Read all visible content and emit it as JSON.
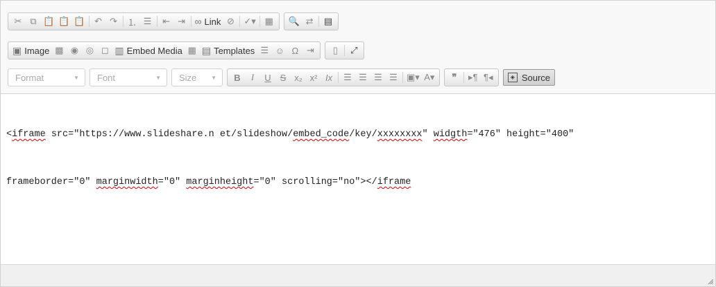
{
  "toolbar": {
    "row1": {
      "link_label": "Link"
    },
    "row2": {
      "image_label": "Image",
      "embed_media_label": "Embed Media",
      "templates_label": "Templates"
    },
    "row3": {
      "format_combo": "Format",
      "font_combo": "Font",
      "size_combo": "Size",
      "source_label": "Source"
    }
  },
  "content": {
    "line1": {
      "p0": "<",
      "w_iframe": "iframe",
      "p1": " src=\"https://www.slideshare.n et/slideshow/",
      "w_embed": "embed_code",
      "p2": "/key/",
      "w_xxx": "xxxxxxxx",
      "p3": "\" ",
      "w_widgth": "widgth",
      "p4": "=\"476\" height=\"400\""
    },
    "line2": {
      "p0": "frameborder=\"0\" ",
      "w_marginwidth": "marginwidth",
      "p1": "=\"0\" ",
      "w_marginheight": "marginheight",
      "p2": "=\"0\" scrolling=\"no\"></",
      "w_iframe": "iframe"
    }
  }
}
